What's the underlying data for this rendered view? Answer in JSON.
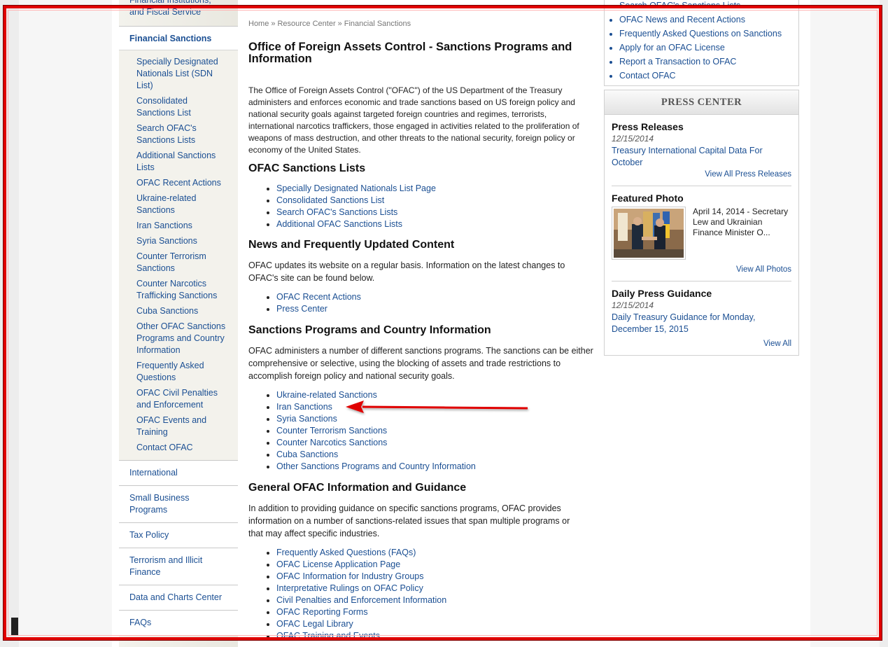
{
  "leftnav": {
    "prev_item": "Financial Institutions, and Fiscal Service",
    "current": "Financial Sanctions",
    "sub_items": [
      "Specially Designated Nationals List (SDN List)",
      "Consolidated Sanctions List",
      "Search OFAC's Sanctions Lists",
      "Additional Sanctions Lists",
      "OFAC Recent Actions",
      "Ukraine-related Sanctions",
      "Iran Sanctions",
      "Syria Sanctions",
      "Counter Terrorism Sanctions",
      "Counter Narcotics Trafficking Sanctions",
      "Cuba Sanctions",
      "Other OFAC Sanctions Programs and Country Information",
      "Frequently Asked Questions",
      "OFAC Civil Penalties and Enforcement",
      "OFAC Events and Training",
      "Contact OFAC"
    ],
    "top_items": [
      "International",
      "Small Business Programs",
      "Tax Policy",
      "Terrorism and Illicit Finance",
      "Data and Charts Center",
      "FAQs"
    ]
  },
  "breadcrumb": [
    "Home",
    "Resource Center",
    "Financial Sanctions"
  ],
  "breadcrumb_sep": "»",
  "page_title": "Office of Foreign Assets Control - Sanctions Programs and Information",
  "intro": "The Office of Foreign Assets Control (\"OFAC\") of the US Department of the Treasury administers and enforces economic and trade sanctions based on US foreign policy and national security goals against targeted foreign countries and regimes, terrorists, international narcotics traffickers, those engaged in activities related to the proliferation of weapons of mass destruction, and other threats to the national security, foreign policy or economy of the United States.",
  "sections": {
    "lists": {
      "heading": "OFAC Sanctions Lists",
      "links": [
        "Specially Designated Nationals List Page",
        "Consolidated Sanctions List",
        "Search OFAC's Sanctions Lists",
        "Additional OFAC Sanctions Lists"
      ]
    },
    "news": {
      "heading": "News and Frequently Updated Content",
      "text": "OFAC updates its website on a regular basis. Information on the latest changes to OFAC's site can be found below.",
      "links": [
        "OFAC Recent Actions",
        "Press Center"
      ]
    },
    "programs": {
      "heading": "Sanctions Programs and Country Information",
      "text": "OFAC administers a number of different sanctions programs. The sanctions can be either comprehensive or selective, using the blocking of assets and trade restrictions to accomplish foreign policy and national security goals.",
      "links": [
        "Ukraine-related Sanctions",
        "Iran Sanctions",
        "Syria Sanctions",
        "Counter Terrorism Sanctions",
        "Counter Narcotics Sanctions",
        "Cuba Sanctions",
        "Other Sanctions Programs and Country Information"
      ]
    },
    "general": {
      "heading": "General OFAC Information and Guidance",
      "text": "In addition to providing guidance on specific sanctions programs, OFAC provides information on a number of sanctions-related issues that span multiple programs or that may affect specific industries.",
      "links": [
        "Frequently Asked Questions (FAQs)",
        "OFAC License Application Page",
        "OFAC Information for Industry Groups",
        "Interpretative Rulings on OFAC Policy",
        "Civil Penalties and Enforcement Information",
        "OFAC Reporting Forms",
        "OFAC Legal Library",
        "OFAC Training and Events"
      ]
    }
  },
  "quick_links": [
    "Search OFAC's Sanctions Lists",
    "OFAC News and Recent Actions",
    "Frequently Asked Questions on Sanctions",
    "Apply for an OFAC License",
    "Report a Transaction to OFAC",
    "Contact OFAC"
  ],
  "press_center": {
    "title": "PRESS CENTER",
    "releases": {
      "heading": "Press Releases",
      "date": "12/15/2014",
      "link": "Treasury International Capital Data For October",
      "view_all": "View All Press Releases"
    },
    "photo": {
      "heading": "Featured Photo",
      "caption": "April 14, 2014 - Secretary Lew and Ukrainian Finance Minister O...",
      "view_all": "View All Photos"
    },
    "guidance": {
      "heading": "Daily Press Guidance",
      "date": "12/15/2014",
      "link": "Daily Treasury Guidance for Monday, December 15, 2015",
      "view_all": "View All"
    }
  },
  "colors": {
    "link": "#1b4f93",
    "annotation": "#e00000"
  }
}
